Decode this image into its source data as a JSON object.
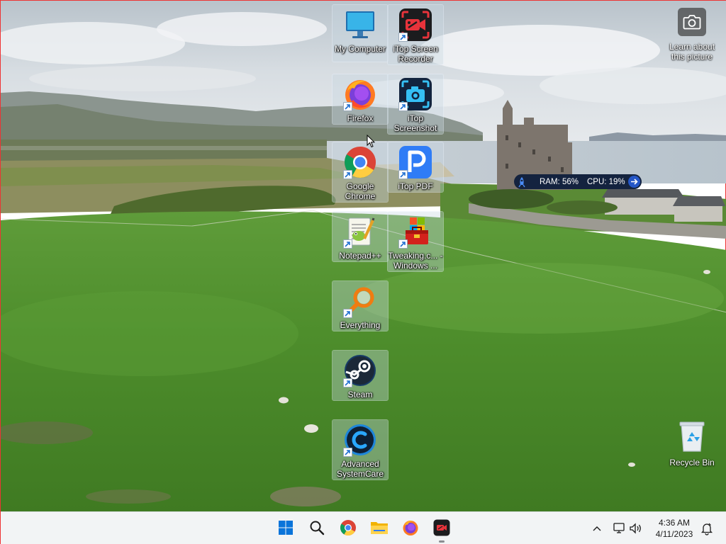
{
  "desktop": {
    "icons": [
      {
        "label": "My Computer",
        "icon": "monitor-icon"
      },
      {
        "label": "iTop Screen Recorder",
        "icon": "screen-recorder-icon"
      },
      {
        "label": "Firefox",
        "icon": "firefox-icon"
      },
      {
        "label": "iTop Screenshot",
        "icon": "screenshot-camera-icon"
      },
      {
        "label": "Google Chrome",
        "icon": "chrome-icon"
      },
      {
        "label": "iTop PDF",
        "icon": "pdf-icon"
      },
      {
        "label": "Notepad++",
        "icon": "notepadpp-icon"
      },
      {
        "label": "Tweaking.c... - Windows ...",
        "icon": "toolbox-icon"
      },
      {
        "label": "Everything",
        "icon": "search-magnifier-icon"
      },
      {
        "label": "Steam",
        "icon": "steam-icon"
      },
      {
        "label": "Advanced SystemCare",
        "icon": "systemcare-icon"
      }
    ],
    "learn_about": "Learn about this picture",
    "recycle_bin": "Recycle Bin"
  },
  "sysmon": {
    "ram": "RAM: 56%",
    "cpu": "CPU: 19%"
  },
  "taskbar": {
    "apps": [
      {
        "icon": "windows-start-icon"
      },
      {
        "icon": "search-icon"
      },
      {
        "icon": "chrome-icon"
      },
      {
        "icon": "file-explorer-icon"
      },
      {
        "icon": "firefox-icon"
      },
      {
        "icon": "screen-recorder-icon",
        "active": true
      }
    ],
    "time": "4:36 AM",
    "date": "4/11/2023"
  },
  "colors": {
    "accent_blue": "#0078d4",
    "taskbar_bg": "#f2f4f5",
    "sysmon_bg": "#14233f"
  }
}
